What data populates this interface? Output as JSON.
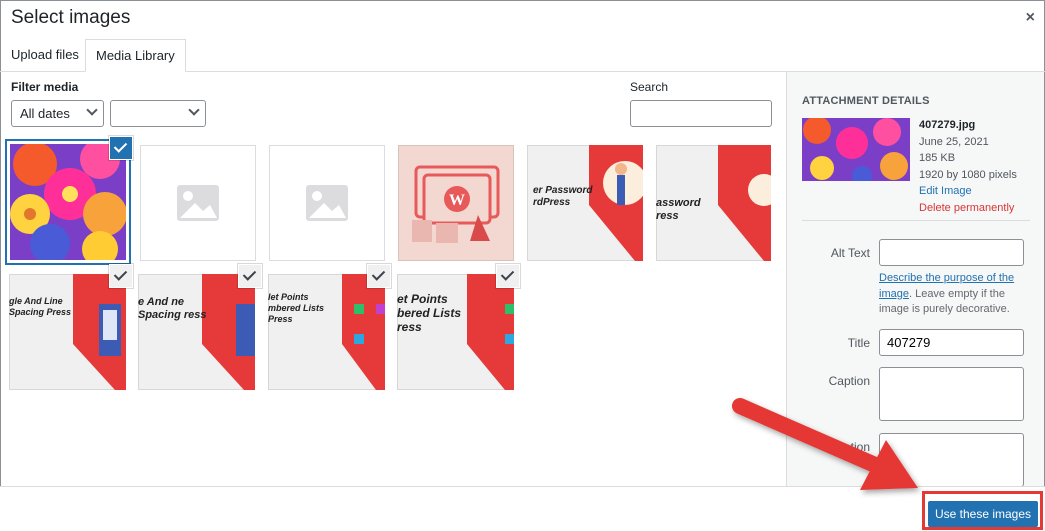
{
  "modal": {
    "title": "Select images",
    "close": "×"
  },
  "tabs": [
    {
      "label": "Upload files"
    },
    {
      "label": "Media Library"
    }
  ],
  "filter": {
    "label": "Filter media",
    "date_select": "All dates",
    "type_select": "",
    "search_label": "Search",
    "search_value": ""
  },
  "grid": {
    "row1": [
      {
        "kind": "flowers",
        "selected": true
      },
      {
        "kind": "placeholder"
      },
      {
        "kind": "placeholder"
      },
      {
        "kind": "wordpress"
      },
      {
        "kind": "password-1",
        "text": "er Password rdPress"
      },
      {
        "kind": "password-2",
        "text": "assword ress"
      }
    ],
    "row2": [
      {
        "kind": "spacing-1",
        "text": "gle And Line Spacing Press",
        "checked": true
      },
      {
        "kind": "spacing-2",
        "text": "e And ne Spacing ress",
        "checked": true
      },
      {
        "kind": "bullets-1",
        "text": "let Points mbered Lists Press",
        "checked": true
      },
      {
        "kind": "bullets-2",
        "text": "et Points bered Lists ress",
        "checked": true
      }
    ]
  },
  "attachment": {
    "heading": "ATTACHMENT DETAILS",
    "filename": "407279.jpg",
    "date": "June 25, 2021",
    "size": "185 KB",
    "dimensions": "1920 by 1080 pixels",
    "edit_label": "Edit Image",
    "delete_label": "Delete permanently",
    "alt_label": "Alt Text",
    "alt_value": "",
    "desc_link": "Describe the purpose of the image",
    "desc_rest": ". Leave empty if the image is purely decorative.",
    "title_label": "Title",
    "title_value": "407279",
    "caption_label": "Caption",
    "description_label": "ption"
  },
  "footer": {
    "button_label": "Use these images"
  },
  "colors": {
    "accent": "#2271b1",
    "annotation": "#e53935"
  }
}
